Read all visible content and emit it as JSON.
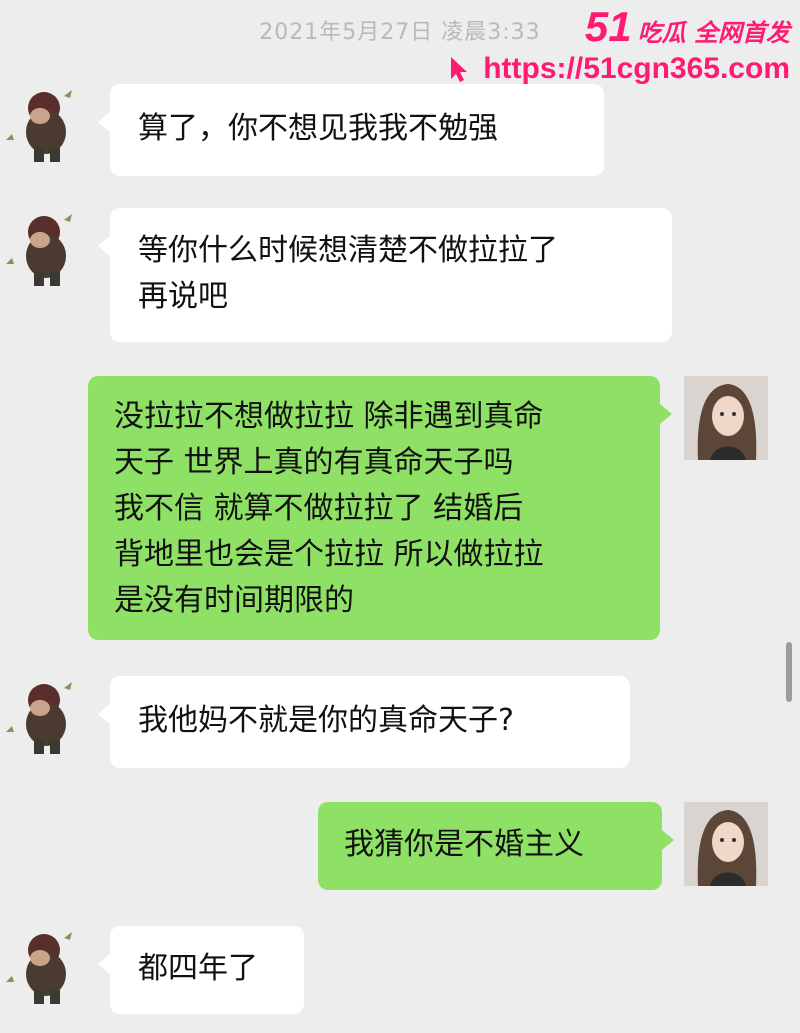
{
  "timestamp": "2021年5月27日 凌晨3:33",
  "watermark": {
    "brand": "51",
    "slogan": "吃瓜 全网首发",
    "url": "https://51cgn365.com"
  },
  "messages": [
    {
      "side": "left",
      "text": "算了，你不想见我我不勉强"
    },
    {
      "side": "left",
      "text": "等你什么时候想清楚不做拉拉了\n再说吧"
    },
    {
      "side": "right",
      "text": "没拉拉不想做拉拉 除非遇到真命\n天子 世界上真的有真命天子吗\n我不信 就算不做拉拉了 结婚后\n背地里也会是个拉拉 所以做拉拉\n是没有时间期限的"
    },
    {
      "side": "left",
      "text": "我他妈不就是你的真命天子?"
    },
    {
      "side": "right",
      "text": "我猜你是不婚主义"
    },
    {
      "side": "left",
      "text": "都四年了"
    }
  ],
  "icons": {
    "left_avatar": "cartoon-character-avatar-icon",
    "right_avatar": "girl-photo-avatar-icon",
    "cursor": "cursor-arrow-icon"
  },
  "colors": {
    "background": "#ededed",
    "incoming_bubble": "#ffffff",
    "outgoing_bubble": "#8fe165",
    "watermark": "#ff1a72"
  }
}
